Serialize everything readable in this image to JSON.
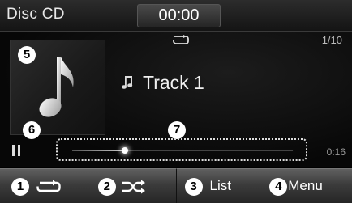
{
  "top_bar": {
    "source": "Disc CD",
    "clock": "00:00"
  },
  "now_playing": {
    "track_counter": "1/10",
    "track_title": "Track 1",
    "elapsed": "0:16",
    "progress_fraction": 0.24
  },
  "callouts": {
    "repeat": "1",
    "shuffle": "2",
    "list": "3",
    "menu": "4",
    "album_art": "5",
    "play_pause": "6",
    "progress": "7"
  },
  "buttons": {
    "list_label": "List",
    "menu_label": "Menu"
  },
  "icons": {
    "repeat": "repeat-icon",
    "shuffle": "shuffle-icon",
    "note": "music-note-icon",
    "pause": "pause-icon"
  }
}
